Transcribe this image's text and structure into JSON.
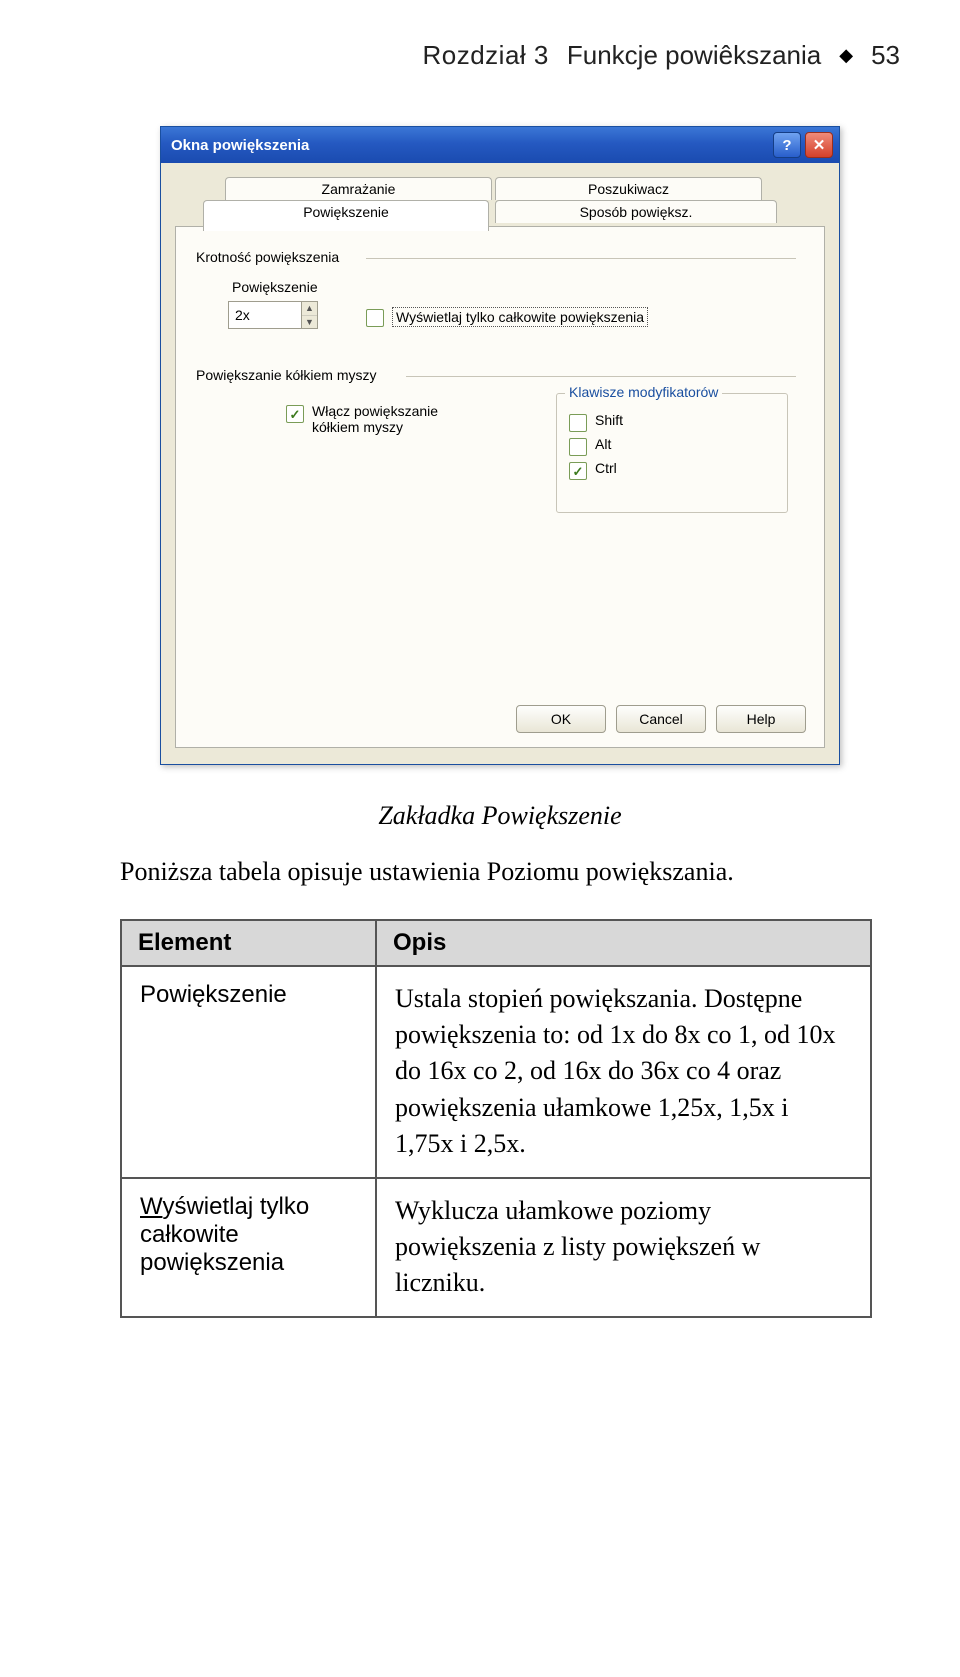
{
  "header": {
    "chapter": "Rozdział 3",
    "title": "Funkcje powiêkszania",
    "page": "53"
  },
  "dialog": {
    "titlebar": "Okna powiększenia",
    "help_glyph": "?",
    "close_glyph": "✕",
    "tabs": {
      "t1": "Zamrażanie",
      "t2": "Poszukiwacz",
      "t3": "Powiększenie",
      "t4": "Sposób powiększ."
    },
    "group1": "Krotność powiększenia",
    "field_label": "Powiększenie",
    "field_value": "2x",
    "checkbox_whole": "Wyświetlaj tylko całkowite powiększenia",
    "group2": "Powiększanie kółkiem myszy",
    "checkbox_wheel_l1": "Włącz powiększanie",
    "checkbox_wheel_l2": "kółkiem myszy",
    "fieldset_legend": "Klawisze modyfikatorów",
    "mod_shift": "Shift",
    "mod_alt": "Alt",
    "mod_ctrl": "Ctrl",
    "btn_ok": "OK",
    "btn_cancel": "Cancel",
    "btn_help": "Help"
  },
  "caption": "Zakładka Powiększenie",
  "intro": "Poniższa tabela opisuje ustawienia Poziomu powiększania.",
  "table": {
    "col1": "Element",
    "col2": "Opis",
    "rows": [
      {
        "name": "Powiększenie",
        "desc": "Ustala stopień powiększania. Dostępne powiększenia to: od 1x do 8x co 1, od 10x do 16x co 2, od 16x do 36x co 4 oraz powiększenia ułamkowe 1,25x, 1,5x i 1,75x i 2,5x."
      },
      {
        "name": "Wyświetlaj tylko całkowite powiększenia",
        "desc": "Wyklucza ułamkowe poziomy powiększenia z listy powiększeń w liczniku."
      }
    ]
  }
}
